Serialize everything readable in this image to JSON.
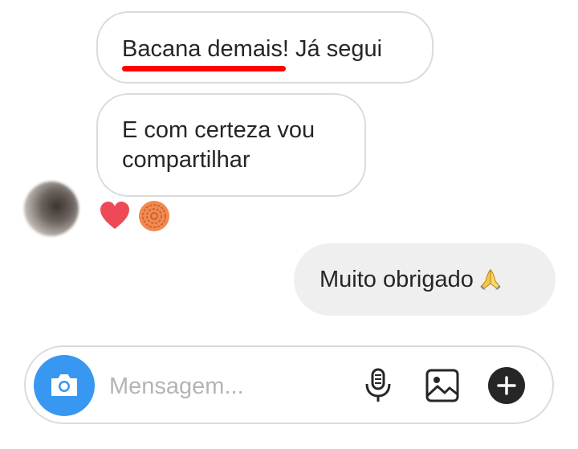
{
  "messages": [
    {
      "text_highlight": "Bacana demais",
      "text_rest": "! Já segui",
      "direction": "received"
    },
    {
      "text": "E com certeza vou compartilhar",
      "direction": "received"
    },
    {
      "text": "Muito obrigado",
      "emoji": "🙏",
      "direction": "sent"
    }
  ],
  "reactions": [
    "heart",
    "sticker"
  ],
  "composer": {
    "placeholder": "Mensagem...",
    "icons": [
      "camera-icon",
      "microphone-icon",
      "gallery-icon",
      "plus-icon"
    ]
  },
  "colors": {
    "accent": "#3897f0",
    "underline": "#ff0000",
    "heart": "#ed4956",
    "sent_bubble": "#efefef",
    "border": "#dbdbdb"
  }
}
